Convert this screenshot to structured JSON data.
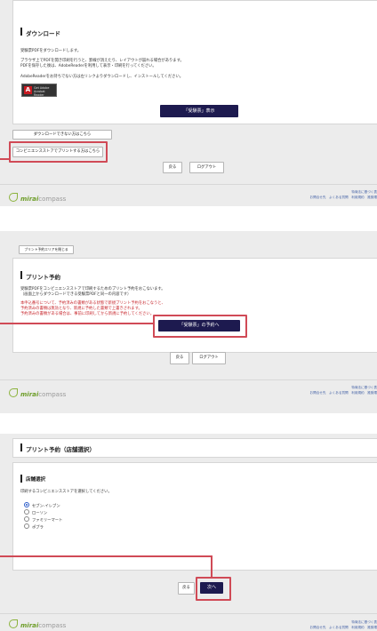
{
  "section1": {
    "title": "ダウンロード",
    "desc1": "受験票PDFをダウンロードします。",
    "desc2": "ブラウザ上でPDFを開き印刷を行うと、罫線が消えたり、レイアウトが崩れる場合があります。",
    "desc3": "PDFを保存した後は、AdobeReaderを利用して表示・印刷を行ってください。",
    "desc4": "AdobeReaderをお持ちでない方は左リンクよりダウンロードし、インストールしてください。",
    "adobe_line1": "Get Adobe",
    "adobe_line2": "Acrobat Reader",
    "show_button": "「受験票」表示",
    "cannot_download": "ダウンロードできない方はこちら",
    "convenience_print": "コンビニエンスストアでプリントする方はこちら",
    "back_button": "戻る",
    "logout_button": "ログアウト"
  },
  "section2": {
    "close_area": "プリント予約エリアを閉じる",
    "title": "プリント予約",
    "desc1": "受験票PDFをコンビニエンスストアで印刷するためのプリント予約をおこないます。",
    "desc2": "（画面上からダウンロードできる受験票PDFと同一の内容です）",
    "red1": "本申込番号について、予約済みの書類がある状態で新規プリント予約をおこなうと、",
    "red2": "予約済みの書類は無効となり、新規に予約した書類で上書きされます。",
    "red3": "予約済みの書類がある場合は、事前に印刷してから新規に予約してください。",
    "reserve_button": "「受験票」の予約へ",
    "back_button": "戻る",
    "logout_button": "ログアウト"
  },
  "section3": {
    "title": "プリント予約（店舗選択）",
    "subtitle": "店舗選択",
    "instruction": "印刷するコンビニエンスストアを選択してください。",
    "stores": [
      "セブン-イレブン",
      "ローソン",
      "ファミリーマート",
      "ポプラ"
    ],
    "back_button": "戻る",
    "next_button": "次へ"
  },
  "footer": {
    "brand": "mirai",
    "brand_rest": "compass",
    "links_line1": "特商法に基づく表",
    "links_line2": "お問合せ先　よくある質問　利用規約　推奨環"
  }
}
